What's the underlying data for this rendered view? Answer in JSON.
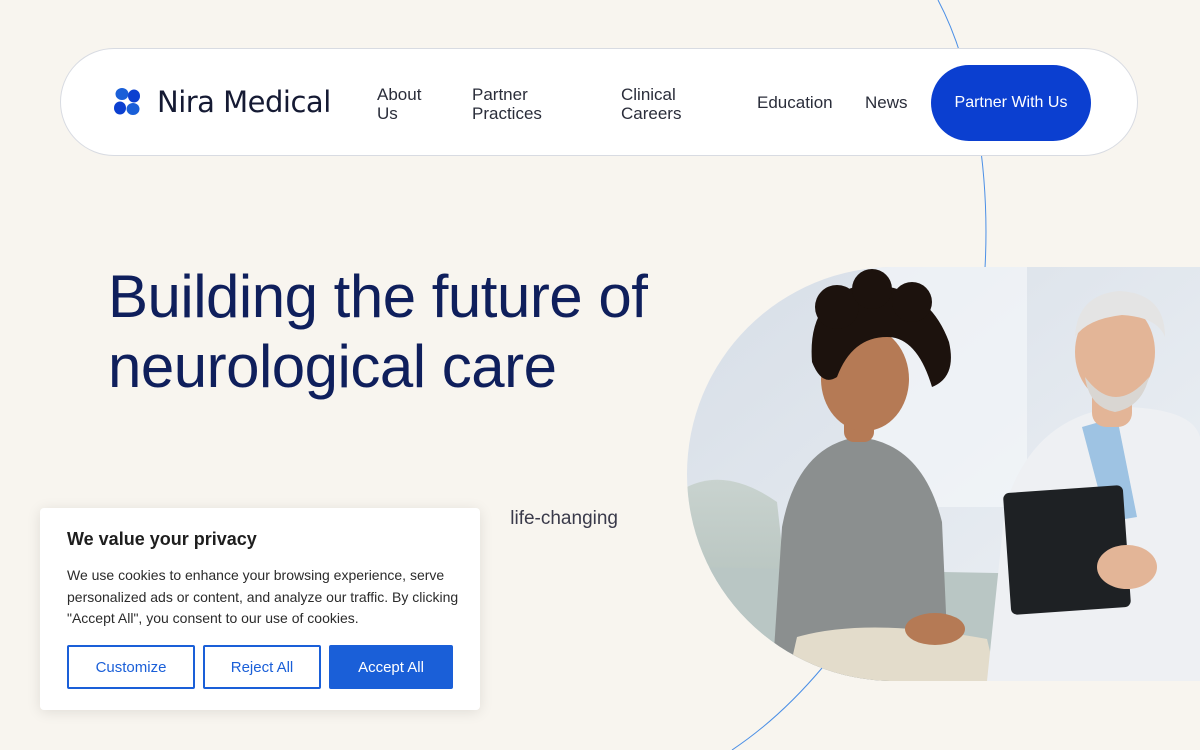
{
  "brand": {
    "name": "Nira Medical",
    "logo_icon": "four-petal-logo-icon",
    "colors": {
      "navy": "#0f1f5c",
      "primary": "#0b3fd0",
      "accent": "#1a5fd8",
      "background": "#f8f5ef"
    }
  },
  "nav": {
    "items": [
      {
        "label": "About Us"
      },
      {
        "label": "Partner Practices"
      },
      {
        "label": "Clinical Careers"
      },
      {
        "label": "Education"
      },
      {
        "label": "News"
      }
    ],
    "cta_label": "Partner With Us"
  },
  "hero": {
    "title": "Building the future of neurological care",
    "subtitle_visible": "life-changing"
  },
  "cookie": {
    "title": "We value your privacy",
    "text": "We use cookies to enhance your browsing experience, serve personalized ads or content, and analyze our traffic. By clicking \"Accept All\", you consent to our use of cookies.",
    "customize_label": "Customize",
    "reject_label": "Reject All",
    "accept_label": "Accept All"
  }
}
